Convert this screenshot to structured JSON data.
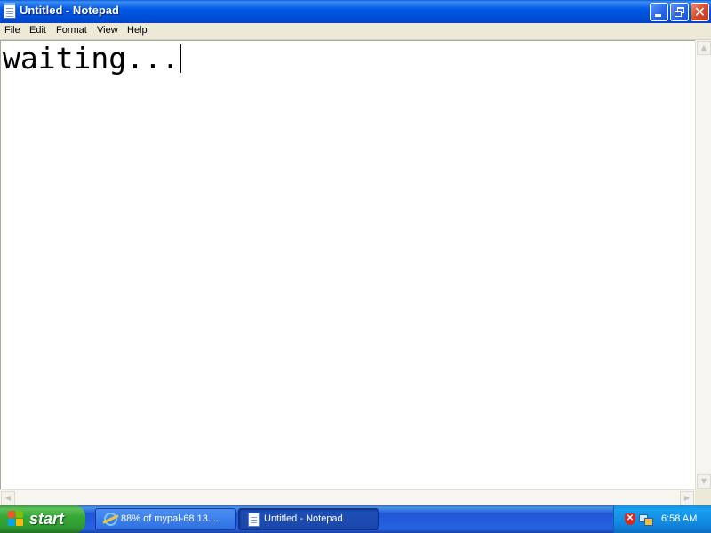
{
  "window": {
    "title": "Untitled - Notepad",
    "title_icon": "notepad-icon",
    "controls": [
      "minimize-icon",
      "restore-icon",
      "close-icon"
    ]
  },
  "menu": {
    "items": [
      {
        "label": "File"
      },
      {
        "label": "Edit"
      },
      {
        "label": "Format"
      },
      {
        "label": "View"
      },
      {
        "label": "Help"
      }
    ]
  },
  "editor": {
    "content": "waiting..."
  },
  "scrollbar": {
    "up": "▲",
    "down": "▼",
    "left": "◀",
    "right": "▶"
  },
  "taskbar": {
    "start_label": "start",
    "buttons": [
      {
        "label": "88% of mypal-68.13....",
        "icon": "internet-explorer-icon",
        "active": false
      },
      {
        "label": "Untitled - Notepad",
        "icon": "notepad-icon",
        "active": true
      }
    ],
    "tray": {
      "icons": [
        "security-shield-icon",
        "network-icon"
      ],
      "clock": "6:58 AM"
    }
  },
  "colors": {
    "titlebar": "#0058e6",
    "taskbar": "#245edb",
    "start_button": "#37a837",
    "menubar": "#ece9d8",
    "tray": "#0f86df"
  }
}
